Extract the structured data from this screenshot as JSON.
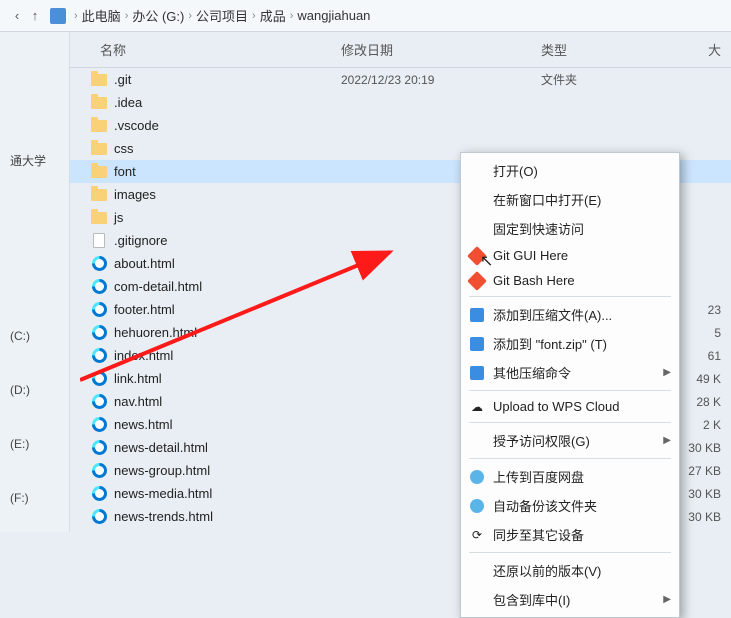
{
  "breadcrumb": {
    "items": [
      "此电脑",
      "办公 (G:)",
      "公司项目",
      "成品",
      "wangjiahuan"
    ]
  },
  "columns": {
    "name": "名称",
    "modified": "修改日期",
    "type": "类型",
    "size": "大"
  },
  "files": [
    {
      "icon": "folder",
      "name": ".git",
      "mod": "2022/12/23 20:19",
      "type": "文件夹",
      "size": ""
    },
    {
      "icon": "folder",
      "name": ".idea",
      "mod": "",
      "type": "",
      "size": ""
    },
    {
      "icon": "folder",
      "name": ".vscode",
      "mod": "",
      "type": "",
      "size": ""
    },
    {
      "icon": "folder",
      "name": "css",
      "mod": "",
      "type": "",
      "size": ""
    },
    {
      "icon": "folder",
      "name": "font",
      "mod": "",
      "type": "",
      "size": "",
      "selected": true
    },
    {
      "icon": "folder",
      "name": "images",
      "mod": "",
      "type": "",
      "size": ""
    },
    {
      "icon": "folder",
      "name": "js",
      "mod": "",
      "type": "",
      "size": ""
    },
    {
      "icon": "file",
      "name": ".gitignore",
      "mod": "",
      "type": "",
      "size": ""
    },
    {
      "icon": "edge",
      "name": "about.html",
      "mod": "",
      "type": "",
      "size": ""
    },
    {
      "icon": "edge",
      "name": "com-detail.html",
      "mod": "",
      "type": "",
      "size": ""
    },
    {
      "icon": "edge",
      "name": "footer.html",
      "mod": "",
      "type": "",
      "size": "23"
    },
    {
      "icon": "edge",
      "name": "hehuoren.html",
      "mod": "",
      "type": "",
      "size": "5"
    },
    {
      "icon": "edge",
      "name": "index.html",
      "mod": "",
      "type": "",
      "size": "61"
    },
    {
      "icon": "edge",
      "name": "link.html",
      "mod": "",
      "type": "",
      "size": "49 K"
    },
    {
      "icon": "edge",
      "name": "nav.html",
      "mod": "",
      "type": "",
      "size": "28 K"
    },
    {
      "icon": "edge",
      "name": "news.html",
      "mod": "",
      "type": "",
      "size": "2 K"
    },
    {
      "icon": "edge",
      "name": "news-detail.html",
      "mod": "",
      "type": "",
      "size": "30 KB"
    },
    {
      "icon": "edge",
      "name": "news-group.html",
      "mod": "",
      "type": "",
      "size": "27 KB"
    },
    {
      "icon": "edge",
      "name": "news-media.html",
      "mod": "",
      "type": "",
      "size": "30 KB"
    },
    {
      "icon": "edge",
      "name": "news-trends.html",
      "mod": "",
      "type": "",
      "size": "30 KB"
    }
  ],
  "sidebar": {
    "items": [
      "通大学",
      "",
      "",
      "(C:)",
      "(D:)",
      "(E:)",
      "(F:)"
    ]
  },
  "context_menu": [
    {
      "label": "打开(O)",
      "icon": ""
    },
    {
      "label": "在新窗口中打开(E)",
      "icon": ""
    },
    {
      "label": "固定到快速访问",
      "icon": ""
    },
    {
      "label": "Git GUI Here",
      "icon": "git"
    },
    {
      "label": "Git Bash Here",
      "icon": "git"
    },
    {
      "sep": true
    },
    {
      "label": "添加到压缩文件(A)...",
      "icon": "zip"
    },
    {
      "label": "添加到 \"font.zip\" (T)",
      "icon": "zip"
    },
    {
      "label": "其他压缩命令",
      "icon": "zip",
      "sub": true
    },
    {
      "sep": true
    },
    {
      "label": "Upload to WPS Cloud",
      "icon": "cloud"
    },
    {
      "sep": true
    },
    {
      "label": "授予访问权限(G)",
      "icon": "",
      "sub": true
    },
    {
      "sep": true
    },
    {
      "label": "上传到百度网盘",
      "icon": "baidu"
    },
    {
      "label": "自动备份该文件夹",
      "icon": "baidu"
    },
    {
      "label": "同步至其它设备",
      "icon": "sync"
    },
    {
      "sep": true
    },
    {
      "label": "还原以前的版本(V)",
      "icon": ""
    },
    {
      "label": "包含到库中(I)",
      "icon": "",
      "sub": true
    }
  ]
}
